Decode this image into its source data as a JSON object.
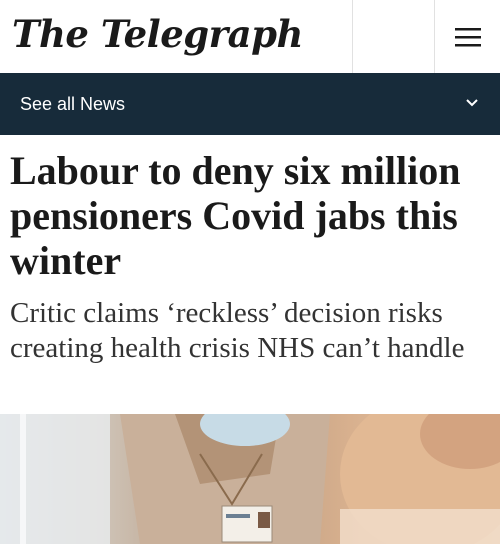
{
  "header": {
    "logo": "The Telegraph",
    "menu_icon": "hamburger-menu-icon"
  },
  "nav": {
    "label": "See all News",
    "chevron_icon": "chevron-down-icon"
  },
  "article": {
    "headline": "Labour to deny six million pensioners Covid jabs this winter",
    "standfirst": "Critic claims ‘reckless’ decision risks creating health crisis NHS can’t handle"
  },
  "colors": {
    "nav_background": "#172b3a",
    "headline_text": "#1a1a1a"
  }
}
